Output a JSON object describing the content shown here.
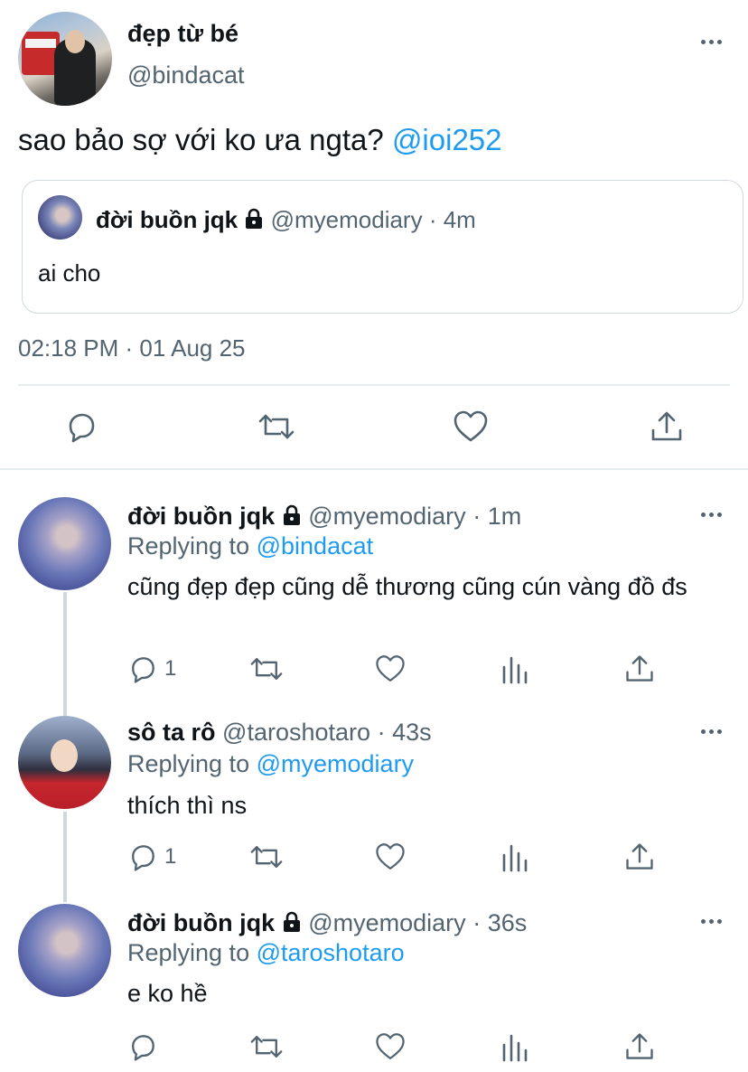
{
  "main_tweet": {
    "display_name": "đẹp từ bé",
    "handle": "@bindacat",
    "text": "sao bảo sợ với ko ưa ngta?",
    "mention": "@ioi252",
    "timestamp": "02:18 PM · 01 Aug 25",
    "quote": {
      "display_name": "đời buồn jqk",
      "handle": "@myemodiary",
      "time": "4m",
      "text": "ai cho"
    }
  },
  "replies": [
    {
      "display_name": "đời buồn jqk",
      "handle": "@myemodiary",
      "time": "1m",
      "replying_prefix": "Replying to",
      "replying_to": "@bindacat",
      "text": "cũng đẹp đẹp cũng dễ thương cũng cún vàng đồ đs",
      "reply_count": "1",
      "locked": true
    },
    {
      "display_name": "sô ta rô",
      "handle": "@taroshotaro",
      "time": "43s",
      "replying_prefix": "Replying to",
      "replying_to": "@myemodiary",
      "text": "thích thì ns",
      "reply_count": "1",
      "locked": false
    },
    {
      "display_name": "đời buồn jqk",
      "handle": "@myemodiary",
      "time": "36s",
      "replying_prefix": "Replying to",
      "replying_to": "@taroshotaro",
      "text": "e ko hề",
      "reply_count": "",
      "locked": true
    }
  ],
  "colors": {
    "accent": "#1d9bf0",
    "secondary_text": "#536471",
    "border": "#cfd9de"
  },
  "icons": [
    "more-icon",
    "reply-icon",
    "retweet-icon",
    "like-icon",
    "share-icon",
    "analytics-icon",
    "lock-icon"
  ]
}
